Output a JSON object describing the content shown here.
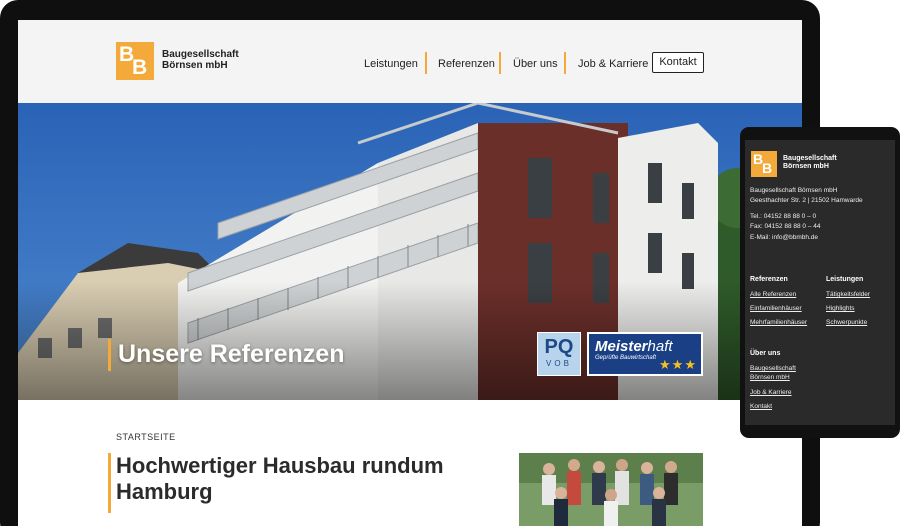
{
  "brand": {
    "logo_letters": [
      "B",
      "B"
    ],
    "name_line1": "Baugesellschaft",
    "name_line2": "Börnsen mbH",
    "accent_color": "#f4a93b"
  },
  "nav": {
    "items": [
      "Leistungen",
      "Referenzen",
      "Über uns",
      "Job & Karriere"
    ],
    "cta": "Kontakt"
  },
  "hero": {
    "title": "Unsere Referenzen",
    "badge_pq_big": "PQ",
    "badge_pq_small": "VOB",
    "badge_meister_1": "Meister",
    "badge_meister_2": "haft",
    "badge_meister_sub": "Geprüfte Bauwirtschaft",
    "badge_stars": "★★★"
  },
  "content": {
    "breadcrumb": "STARTSEITE",
    "headline": "Hochwertiger Hausbau rundum Hamburg"
  },
  "mobile": {
    "brand_line1": "Baugesellschaft",
    "brand_line2": "Börnsen mbH",
    "company": "Baugesellschaft Börnsen mbH",
    "address": "Geesthachter Str. 2 | 21502 Hamwarde",
    "phone": "Tel.: 04152 88 88 0 – 0",
    "fax": "Fax: 04152 88 88 0 – 44",
    "email": "E-Mail: info@bbmbh.de",
    "col1_heading": "Referenzen",
    "col1_links": [
      "Alle Referenzen",
      "Einfamilienhäuser",
      "Mehrfamilienhäuser"
    ],
    "col2_heading": "Leistungen",
    "col2_links": [
      "Tätigkeitsfelder",
      "Highlights",
      "Schwerpunkte"
    ],
    "col3_heading": "Über uns",
    "col3_links": [
      "Baugesellschaft",
      "Börnsen mbH",
      "Job & Karriere",
      "Kontakt"
    ]
  }
}
